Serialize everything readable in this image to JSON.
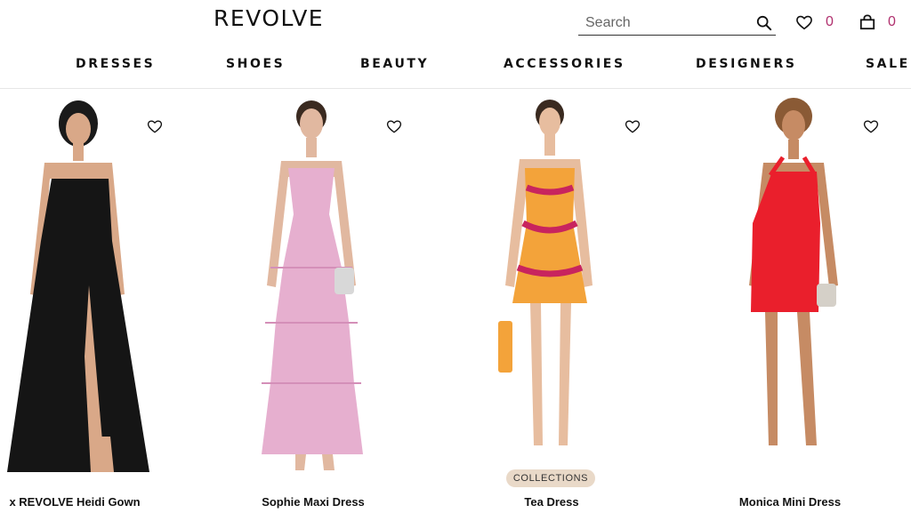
{
  "brand": {
    "logo": "REVOLVE"
  },
  "search": {
    "placeholder": "Search"
  },
  "header": {
    "wishlist_count": "0",
    "bag_count": "0"
  },
  "nav": {
    "items": [
      {
        "label": "DRESSES"
      },
      {
        "label": "SHOES"
      },
      {
        "label": "BEAUTY"
      },
      {
        "label": "ACCESSORIES"
      },
      {
        "label": "DESIGNERS"
      },
      {
        "label": "SALE"
      }
    ]
  },
  "products": [
    {
      "name": "x REVOLVE Heidi Gown",
      "color": "#151515"
    },
    {
      "name": "Sophie Maxi Dress",
      "color": "#e6afcf"
    },
    {
      "name": "Tea Dress",
      "color": "#f3a33a",
      "badge": "COLLECTIONS"
    },
    {
      "name": "Monica Mini Dress",
      "color": "#ea1f2c"
    }
  ],
  "colors": {
    "accent": "#b0306e",
    "badge_bg": "#e9d9c8",
    "divider": "#e6e6e6"
  }
}
